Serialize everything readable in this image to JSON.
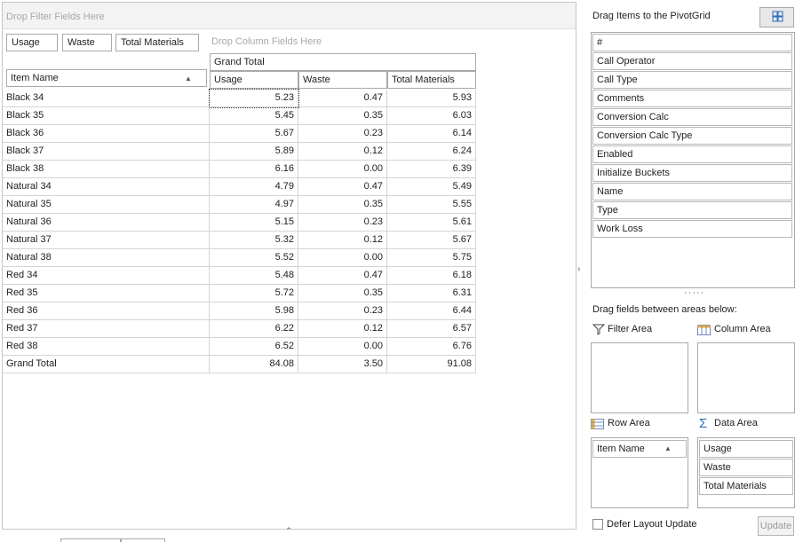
{
  "filter_area_hint": "Drop Filter Fields Here",
  "column_area_hint": "Drop Column Fields Here",
  "data_field_headers": [
    "Usage",
    "Waste",
    "Total Materials"
  ],
  "row_field": "Item Name",
  "column_group": "Grand Total",
  "columns": [
    "Usage",
    "Waste",
    "Total Materials"
  ],
  "rows": [
    {
      "name": "Black 34",
      "usage": "5.23",
      "waste": "0.47",
      "total": "5.93"
    },
    {
      "name": "Black 35",
      "usage": "5.45",
      "waste": "0.35",
      "total": "6.03"
    },
    {
      "name": "Black 36",
      "usage": "5.67",
      "waste": "0.23",
      "total": "6.14"
    },
    {
      "name": "Black 37",
      "usage": "5.89",
      "waste": "0.12",
      "total": "6.24"
    },
    {
      "name": "Black 38",
      "usage": "6.16",
      "waste": "0.00",
      "total": "6.39"
    },
    {
      "name": "Natural 34",
      "usage": "4.79",
      "waste": "0.47",
      "total": "5.49"
    },
    {
      "name": "Natural 35",
      "usage": "4.97",
      "waste": "0.35",
      "total": "5.55"
    },
    {
      "name": "Natural 36",
      "usage": "5.15",
      "waste": "0.23",
      "total": "5.61"
    },
    {
      "name": "Natural 37",
      "usage": "5.32",
      "waste": "0.12",
      "total": "5.67"
    },
    {
      "name": "Natural 38",
      "usage": "5.52",
      "waste": "0.00",
      "total": "5.75"
    },
    {
      "name": "Red 34",
      "usage": "5.48",
      "waste": "0.47",
      "total": "6.18"
    },
    {
      "name": "Red 35",
      "usage": "5.72",
      "waste": "0.35",
      "total": "6.31"
    },
    {
      "name": "Red 36",
      "usage": "5.98",
      "waste": "0.23",
      "total": "6.44"
    },
    {
      "name": "Red 37",
      "usage": "6.22",
      "waste": "0.12",
      "total": "6.57"
    },
    {
      "name": "Red 38",
      "usage": "6.52",
      "waste": "0.00",
      "total": "6.76"
    }
  ],
  "grand_total": {
    "name": "Grand Total",
    "usage": "84.08",
    "waste": "3.50",
    "total": "91.08"
  },
  "side": {
    "title": "Drag Items to the PivotGrid",
    "fields": [
      "#",
      "Call Operator",
      "Call Type",
      "Comments",
      "Conversion Calc",
      "Conversion Calc Type",
      "Enabled",
      "Initialize Buckets",
      "Name",
      "Type",
      "Work Loss"
    ],
    "areas_hint": "Drag fields between areas below:",
    "filter_area": "Filter Area",
    "column_area": "Column Area",
    "row_area": "Row Area",
    "data_area": "Data Area",
    "row_items": [
      "Item Name"
    ],
    "data_items": [
      "Usage",
      "Waste",
      "Total Materials"
    ],
    "defer_label": "Defer Layout Update",
    "update_label": "Update"
  },
  "colors": {
    "border": "#a9a9a9",
    "accent": "#2a6ebb"
  }
}
